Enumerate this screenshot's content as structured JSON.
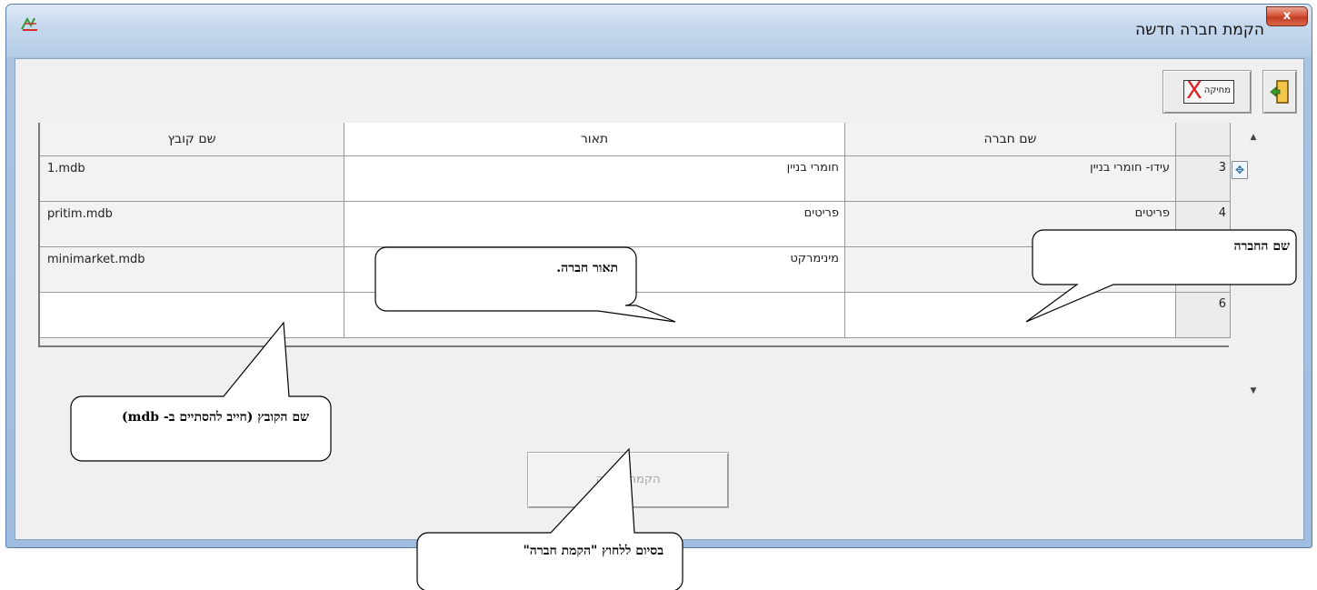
{
  "window": {
    "title": "הקמת חברה חדשה",
    "close_label": "x"
  },
  "toolbar": {
    "delete_label": "מחיקה",
    "delete_symbol": "X"
  },
  "grid": {
    "headers": {
      "file": "שם קובץ",
      "description": "תאור",
      "company": "שם חברה"
    },
    "rows": [
      {
        "num": "3",
        "company": "עידו- חומרי בניין",
        "description": "חומרי בניין",
        "file": "1.mdb"
      },
      {
        "num": "4",
        "company": "פריטים",
        "description": "פריטים",
        "file": "pritim.mdb"
      },
      {
        "num": "",
        "company": "",
        "description": "מינימרקט",
        "file": "minimarket.mdb"
      },
      {
        "num": "6",
        "company": "",
        "description": "",
        "file": ""
      }
    ]
  },
  "create_button": {
    "label": "הקמת חברה"
  },
  "callouts": {
    "company_name": "שם החברה",
    "description": "תאור חברה.",
    "file_name": "שם הקובץ (חייב להסתיים ב- mdb)",
    "finish": "בסיום ללחוץ \"הקמת חברה\""
  },
  "colors": {
    "titlebar": "#c7d9ee",
    "client_bg": "#f0f0f0",
    "close_button": "#d6563c",
    "delete_x": "#e02020"
  }
}
